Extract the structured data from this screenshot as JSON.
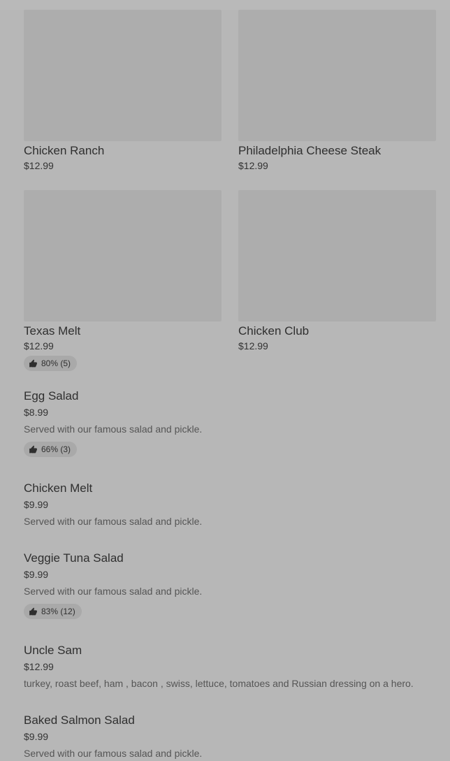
{
  "grid_items": [
    {
      "name": "Chicken Ranch",
      "price": "$12.99"
    },
    {
      "name": "Philadelphia Cheese Steak",
      "price": "$12.99"
    },
    {
      "name": "Texas Melt",
      "price": "$12.99",
      "rating": "80% (5)"
    },
    {
      "name": "Chicken Club",
      "price": "$12.99"
    }
  ],
  "list_items": [
    {
      "name": "Egg Salad",
      "price": "$8.99",
      "description": "Served with our famous salad and pickle.",
      "rating": "66% (3)"
    },
    {
      "name": "Chicken Melt",
      "price": "$9.99",
      "description": "Served with our famous salad and pickle."
    },
    {
      "name": "Veggie Tuna Salad",
      "price": "$9.99",
      "description": "Served with our famous salad and pickle.",
      "rating": "83% (12)"
    },
    {
      "name": "Uncle Sam",
      "price": "$12.99",
      "description": "turkey, roast beef, ham , bacon , swiss, lettuce, tomatoes and Russian dressing on a hero."
    },
    {
      "name": "Baked Salmon Salad",
      "price": "$9.99",
      "description": "Served with our famous salad and pickle."
    }
  ],
  "icons": {
    "rating": "thumbs-up-icon"
  },
  "colors": {
    "overlay": "#b7b7b7",
    "image_placeholder": "#adadad",
    "pill": "#a9a9a9"
  }
}
